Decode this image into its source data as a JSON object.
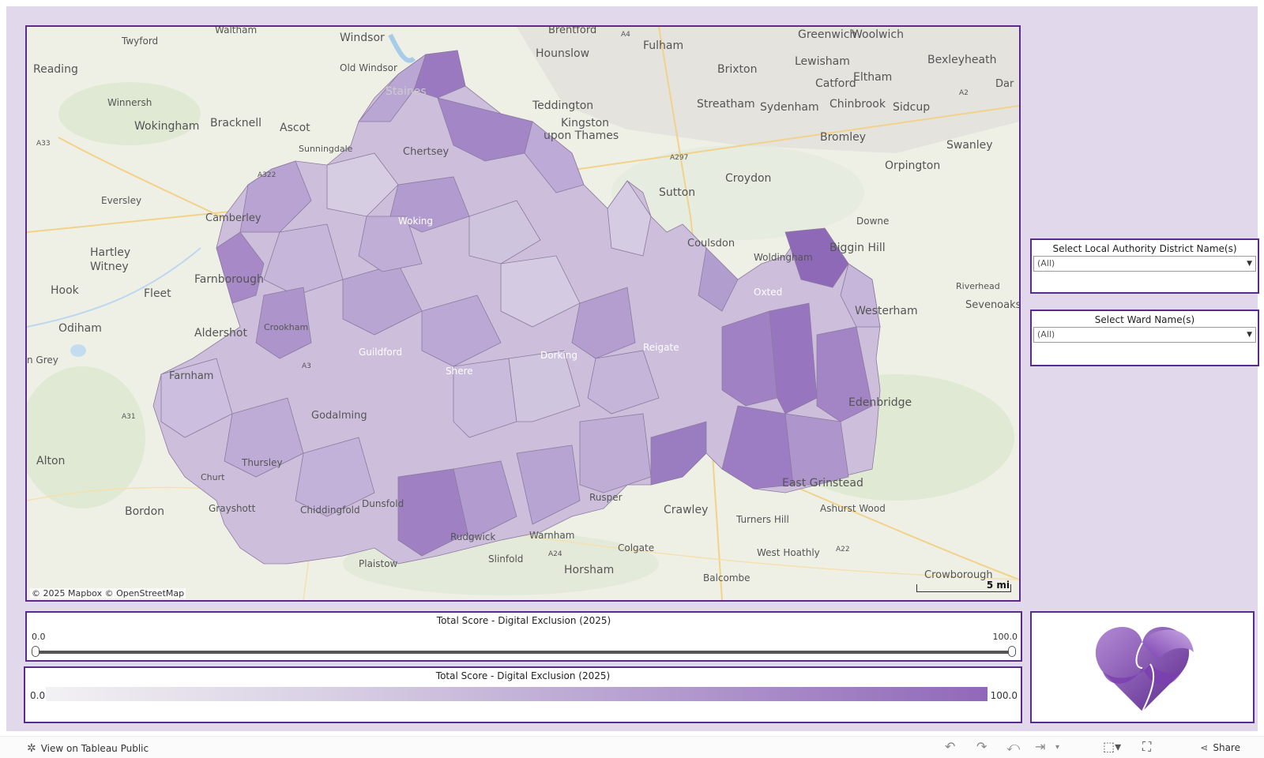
{
  "map": {
    "attribution": "© 2025 Mapbox  © OpenStreetMap",
    "scale_label": "5 mi",
    "place_labels": [
      "Waltham",
      "Windsor",
      "Brentford",
      "Fulham",
      "Greenwich",
      "Woolwich",
      "Twyford",
      "Hounslow",
      "Reading",
      "Old Windsor",
      "Staines",
      "Teddington",
      "Brixton",
      "Lewisham",
      "Bexleyheath",
      "Catford",
      "Eltham",
      "Winnersh",
      "Kingston",
      "upon Thames",
      "Streatham",
      "Sydenham",
      "Chinbrook",
      "Sidcup",
      "Wokingham",
      "Bracknell",
      "Ascot",
      "Sunningdale",
      "Bromley",
      "Swanley",
      "Orpington",
      "Croydon",
      "Chertsey",
      "Sutton",
      "Eversley",
      "Camberley",
      "Downe",
      "Hartley",
      "Witney",
      "Farnborough",
      "Coulsdon",
      "Biggin Hill",
      "Hook",
      "Fleet",
      "Woldingham",
      "Riverhead",
      "Sevenoaks",
      "Westerham",
      "Odiham",
      "Aldershot",
      "Crookham",
      "Farnham",
      "Shere",
      "Edenbridge",
      "Godalming",
      "Alton",
      "Thursley",
      "Churt",
      "East Grinstead",
      "Bordon",
      "Grayshott",
      "Chiddingfold",
      "Dunsfold",
      "Rusper",
      "Crawley",
      "Ashurst Wood",
      "Turners Hill",
      "Rudgwick",
      "Warnham",
      "Colgate",
      "West Hoathly",
      "Plaistow",
      "Slinfold",
      "Horsham",
      "Balcombe",
      "Crowborough",
      "A4",
      "A33",
      "A322",
      "A297",
      "A2",
      "A31",
      "A3",
      "A24",
      "A22",
      "Dar",
      "n Grey",
      "Woking",
      "Reigate",
      "Dorking",
      "Oxted",
      "Guildford"
    ]
  },
  "filters": {
    "lad": {
      "title": "Select Local Authority District Name(s)",
      "value": "(All)"
    },
    "ward": {
      "title": "Select Ward Name(s)",
      "value": "(All)"
    }
  },
  "slider": {
    "title": "Total Score - Digital Exclusion (2025)",
    "min": "0.0",
    "max": "100.0"
  },
  "legend": {
    "title": "Total Score - Digital Exclusion (2025)",
    "min": "0.0",
    "max": "100.0"
  },
  "footer": {
    "view_label": "View on Tableau Public",
    "share_label": "Share"
  },
  "colors": {
    "frame": "#5a2a8c",
    "background": "#e2d8ec",
    "fill_light": "#d9d0e4",
    "fill_dark": "#9168b9"
  },
  "icons": [
    "tableau-icon",
    "undo-icon",
    "redo-icon",
    "revert-icon",
    "refresh-icon",
    "download-icon",
    "fullscreen-icon",
    "share-icon"
  ]
}
